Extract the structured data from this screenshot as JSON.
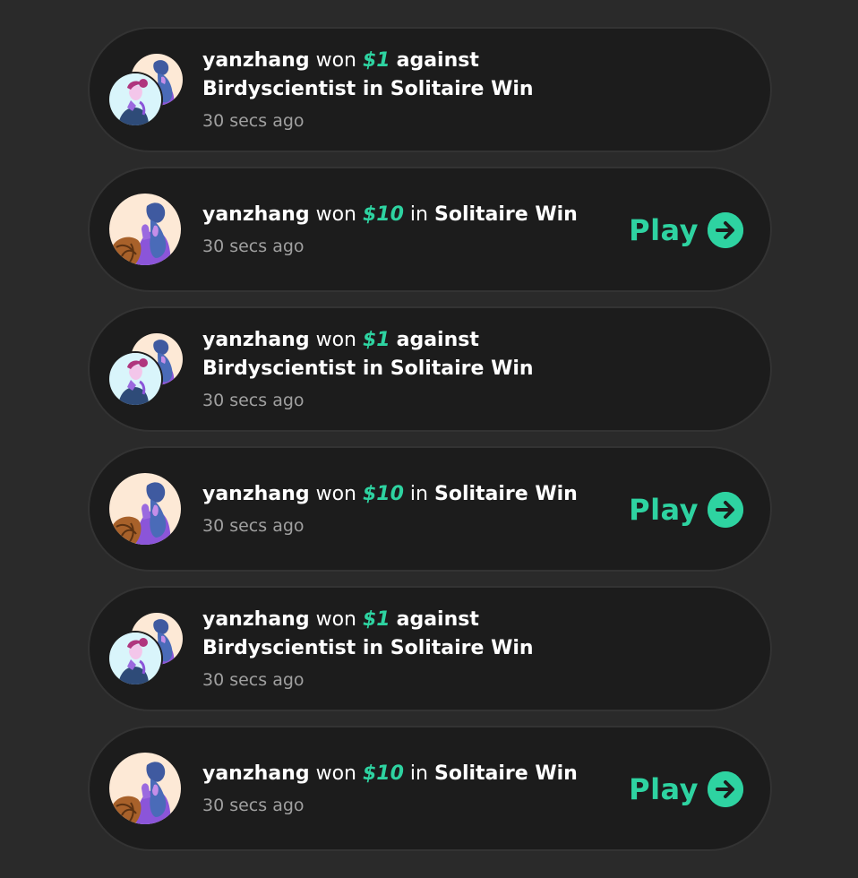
{
  "colors": {
    "background": "#2a2a2a",
    "card": "#1c1c1c",
    "card_border": "#333333",
    "accent": "#2ed3a1",
    "text_primary": "#ffffff",
    "text_secondary": "#a0a0a0"
  },
  "feed": {
    "items": [
      {
        "kind": "match",
        "user": "yanzhang",
        "won_word": "won",
        "amount": "$1",
        "connector": "against",
        "opponent": "Birdyscientist",
        "in_word": "in",
        "game": "Solitaire Win",
        "time": "30 secs ago"
      },
      {
        "kind": "tournament",
        "user": "yanzhang",
        "won_word": "won",
        "amount": "$10",
        "in_word": "in",
        "game": "Solitaire Win",
        "time": "30 secs ago",
        "play_label": "Play",
        "play_icon": "arrow-right-circle-icon"
      },
      {
        "kind": "match",
        "user": "yanzhang",
        "won_word": "won",
        "amount": "$1",
        "connector": "against",
        "opponent": "Birdyscientist",
        "in_word": "in",
        "game": "Solitaire Win",
        "time": "30 secs ago"
      },
      {
        "kind": "tournament",
        "user": "yanzhang",
        "won_word": "won",
        "amount": "$10",
        "in_word": "in",
        "game": "Solitaire Win",
        "time": "30 secs ago",
        "play_label": "Play",
        "play_icon": "arrow-right-circle-icon"
      },
      {
        "kind": "match",
        "user": "yanzhang",
        "won_word": "won",
        "amount": "$1",
        "connector": "against",
        "opponent": "Birdyscientist",
        "in_word": "in",
        "game": "Solitaire Win",
        "time": "30 secs ago"
      },
      {
        "kind": "tournament",
        "user": "yanzhang",
        "won_word": "won",
        "amount": "$10",
        "in_word": "in",
        "game": "Solitaire Win",
        "time": "30 secs ago",
        "play_label": "Play",
        "play_icon": "arrow-right-circle-icon"
      }
    ]
  }
}
